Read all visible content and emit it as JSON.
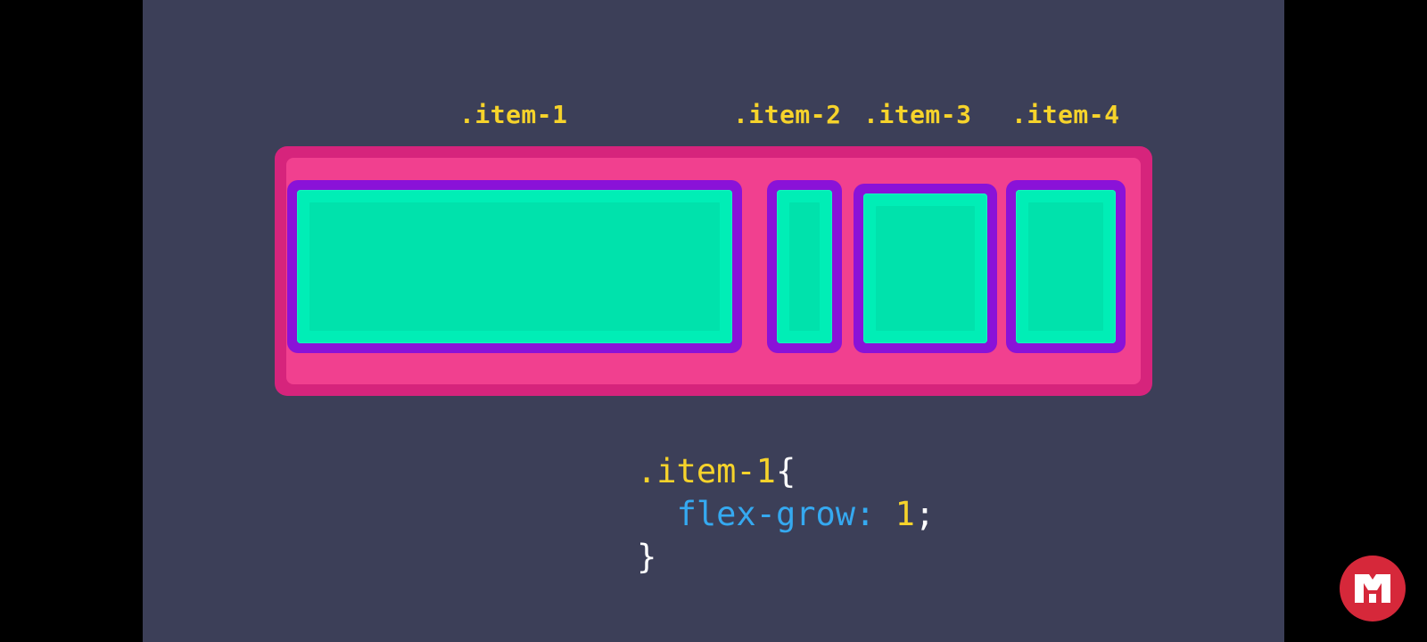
{
  "labels": {
    "item1": ".item-1",
    "item2": ".item-2",
    "item3": ".item-3",
    "item4": ".item-4"
  },
  "code": {
    "selector": ".item-1",
    "open_brace": "{",
    "property": "flex-grow",
    "colon": ":",
    "value": "1",
    "semicolon": ";",
    "close_brace": "}"
  },
  "colors": {
    "background": "#3c3f58",
    "container": "#f1408f",
    "item_border": "#8a12d8",
    "item_fill": "#00e8b0",
    "label": "#f6d32b",
    "property": "#35a9f0",
    "logo": "#d6283a"
  },
  "logo": {
    "icon": "channel-logo-icon"
  }
}
